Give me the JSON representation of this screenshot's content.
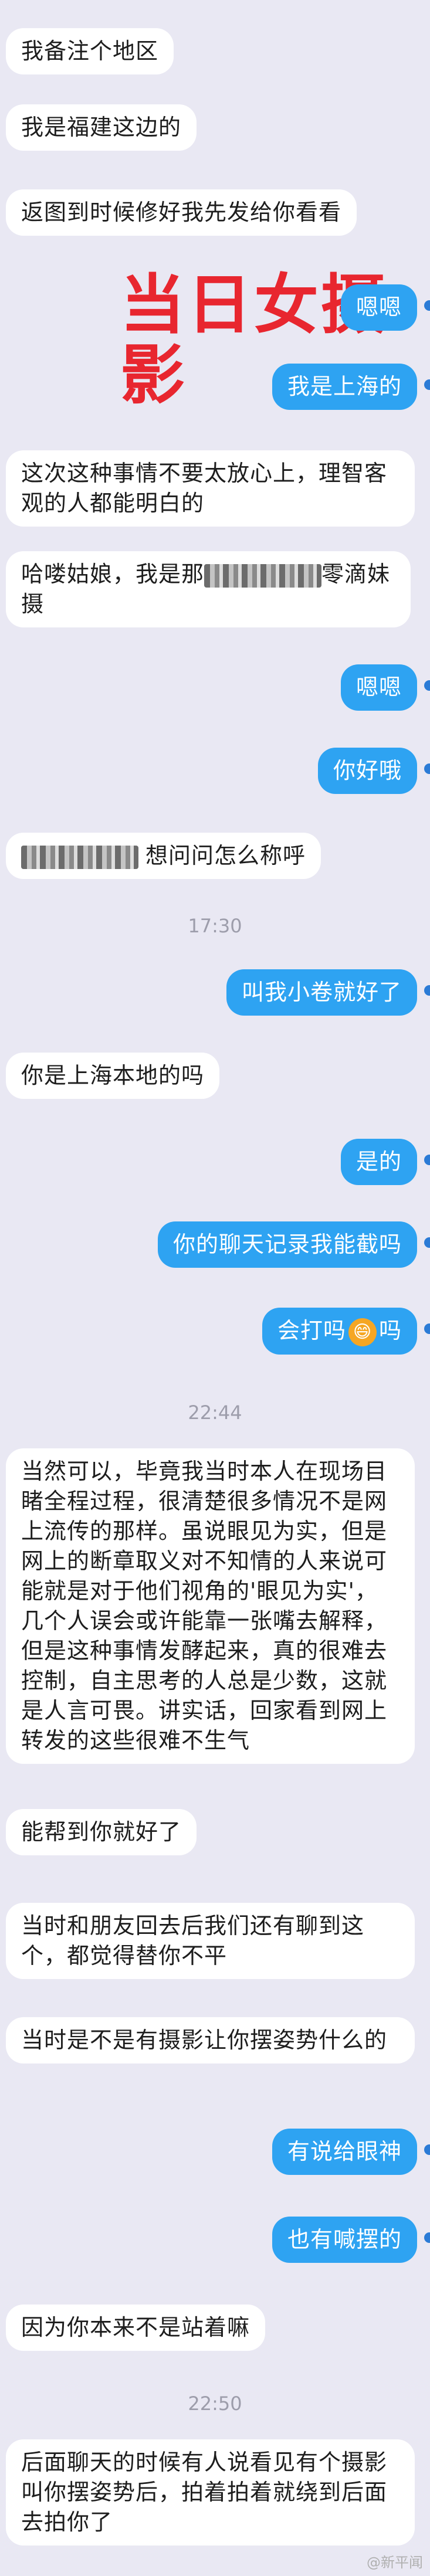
{
  "overlay_title": "当日女摄影",
  "messages": [
    {
      "text": "我备注个地区"
    },
    {
      "text": "我是福建这边的"
    },
    {
      "text": "返图到时候修好我先发给你看看"
    },
    {
      "text": "嗯嗯"
    },
    {
      "text": "我是上海的"
    },
    {
      "text": "这次这种事情不要太放心上，理智客观的人都能明白的"
    },
    {
      "text_a": "哈喽姑娘，我是那",
      "text_b": "零滴妹摄"
    },
    {
      "text": "嗯嗯"
    },
    {
      "text": "你好哦"
    },
    {
      "text": "想问问怎么称呼"
    },
    {
      "text": "17:30"
    },
    {
      "text": "叫我小卷就好了"
    },
    {
      "text": "你是上海本地的吗"
    },
    {
      "text": "是的"
    },
    {
      "text": "你的聊天记录我能截吗"
    },
    {
      "text_a": "会打吗",
      "emoji": "😄",
      "text_b": "吗"
    },
    {
      "text": "22:44"
    },
    {
      "text": "当然可以，毕竟我当时本人在现场目睹全程过程，很清楚很多情况不是网上流传的那样。虽说眼见为实，但是网上的断章取义对不知情的人来说可能就是对于他们视角的'眼见为实'，几个人误会或许能靠一张嘴去解释，但是这种事情发酵起来，真的很难去控制，自主思考的人总是少数，这就是人言可畏。讲实话，回家看到网上转发的这些很难不生气"
    },
    {
      "text": "能帮到你就好了"
    },
    {
      "text": "当时和朋友回去后我们还有聊到这个，都觉得替你不平"
    },
    {
      "text": "当时是不是有摄影让你摆姿势什么的"
    },
    {
      "text": "有说给眼神"
    },
    {
      "text": "也有喊摆的"
    },
    {
      "text": "因为你本来不是站着嘛"
    },
    {
      "text": "22:50"
    },
    {
      "text": "后面聊天的时候有人说看见有个摄影叫你摆姿势后，拍着拍着就绕到后面去拍你了"
    }
  ],
  "watermark": "@新平闻"
}
